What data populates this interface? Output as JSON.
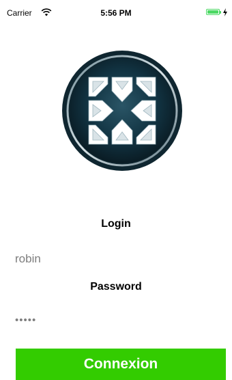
{
  "status_bar": {
    "carrier": "Carrier",
    "time": "5:56 PM",
    "wifi_icon": "wifi-icon",
    "battery_icon": "battery-icon",
    "charging_icon": "charging-icon",
    "battery_level": 1.0,
    "battery_color": "#4cd964"
  },
  "logo": {
    "icon": "snowflake-cube-logo",
    "ring_color": "#1f3a44",
    "inner_color": "#0d2430"
  },
  "form": {
    "login_label": "Login",
    "username_value": "robin",
    "password_label": "Password",
    "password_value": "•••••"
  },
  "button": {
    "label": "Connexion",
    "color": "#33cc00"
  }
}
